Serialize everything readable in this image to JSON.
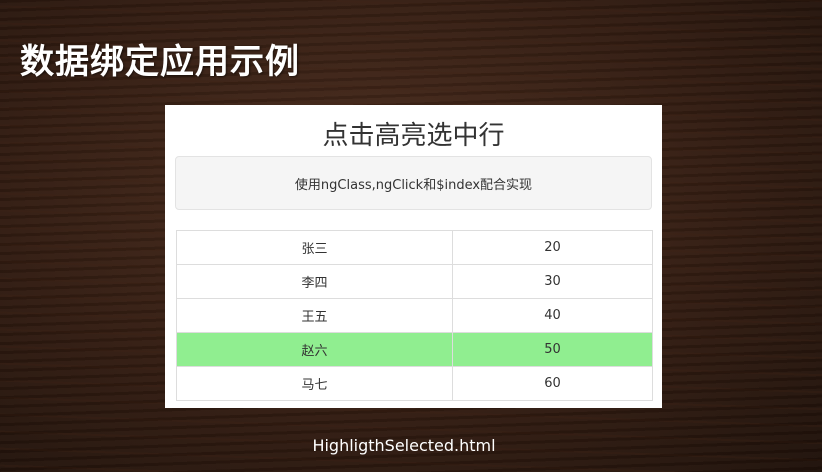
{
  "slide": {
    "title": "数据绑定应用示例",
    "footer_filename": "HighligthSelected.html"
  },
  "demo": {
    "title": "点击高亮选中行",
    "description": "使用ngClass,ngClick和$index配合实现",
    "selected_color": "#90ee90",
    "rows": [
      {
        "name": "张三",
        "value": "20",
        "selected": false
      },
      {
        "name": "李四",
        "value": "30",
        "selected": false
      },
      {
        "name": "王五",
        "value": "40",
        "selected": false
      },
      {
        "name": "赵六",
        "value": "50",
        "selected": true
      },
      {
        "name": "马七",
        "value": "60",
        "selected": false
      }
    ]
  }
}
